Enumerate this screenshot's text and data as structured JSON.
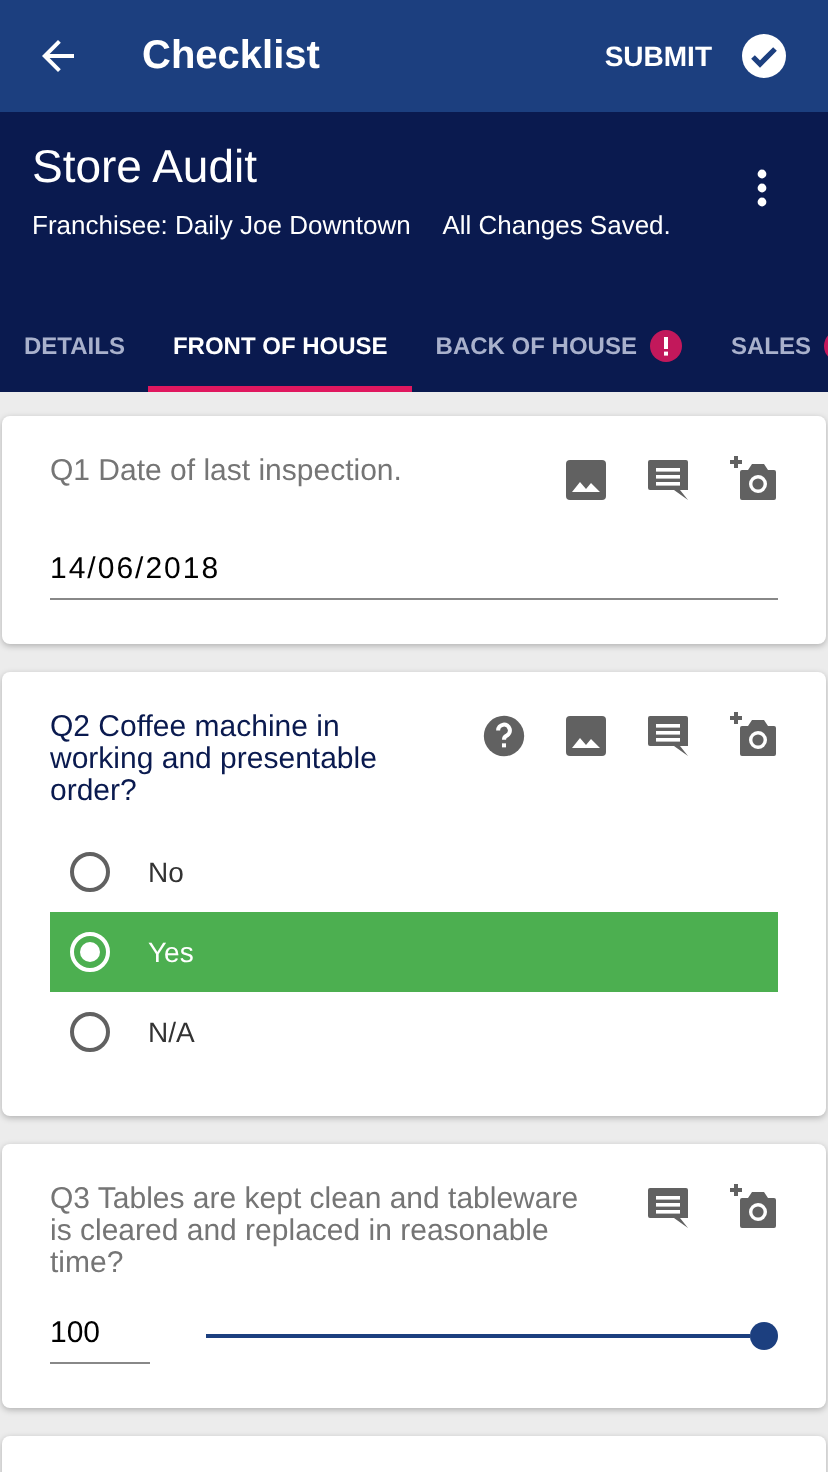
{
  "app_bar": {
    "title": "Checklist",
    "submit": "SUBMIT"
  },
  "header": {
    "title": "Store Audit",
    "subtitle": "Franchisee: Daily Joe Downtown",
    "status": "All Changes Saved."
  },
  "tabs": [
    {
      "label": "DETAILS",
      "selected": false,
      "alert": false
    },
    {
      "label": "FRONT OF HOUSE",
      "selected": true,
      "alert": false
    },
    {
      "label": "BACK OF HOUSE",
      "selected": false,
      "alert": true
    },
    {
      "label": "SALES",
      "selected": false,
      "alert": true
    }
  ],
  "questions": [
    {
      "kind": "date",
      "text": "Q1 Date of last inspection.",
      "current": false,
      "help": false,
      "image": true,
      "comment": true,
      "camera": true,
      "value": "14/06/2018"
    },
    {
      "kind": "choice",
      "text": "Q2 Coffee machine in working and presentable order?",
      "current": true,
      "help": true,
      "image": true,
      "comment": true,
      "camera": true,
      "options": [
        {
          "label": "No",
          "selected": false
        },
        {
          "label": "Yes",
          "selected": true
        },
        {
          "label": "N/A",
          "selected": false
        }
      ]
    },
    {
      "kind": "slider",
      "text": "Q3 Tables are kept clean and tableware is cleared and replaced in reasonable time?",
      "current": false,
      "help": false,
      "image": false,
      "comment": true,
      "camera": true,
      "value": "100",
      "level": 1
    }
  ]
}
